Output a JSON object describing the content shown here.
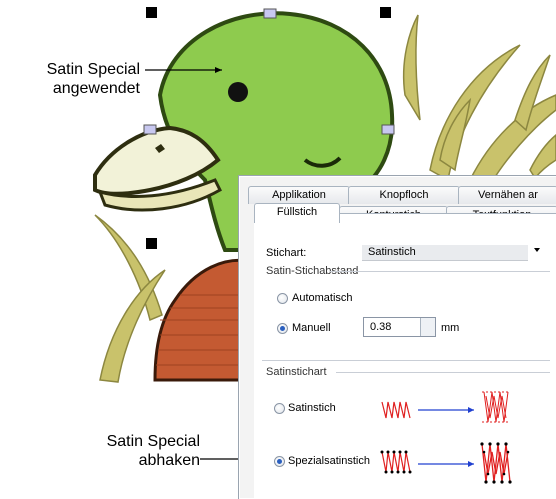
{
  "callouts": {
    "top": [
      "Satin Special",
      "angewendet"
    ],
    "bottom": [
      "Satin Special",
      "abhaken"
    ]
  },
  "dialog": {
    "tabs_back": [
      "Applikation",
      "Knopfloch",
      "Vernähen ar"
    ],
    "tabs_front": [
      "Füllstich",
      "Konturstich",
      "Textfunktion"
    ],
    "active_tab": "Füllstich",
    "stitch_type_label": "Stichart:",
    "stitch_type_value": "Satinstich",
    "spacing_group": "Satin-Stichabstand",
    "auto_label": "Automatisch",
    "manual_label": "Manuell",
    "manual_value": "0.38",
    "unit": "mm",
    "satin_group": "Satinstichart",
    "satin_label": "Satinstich",
    "special_label": "Spezialsatinstich",
    "selected_spacing": "Manuell",
    "selected_satin": "Spezialsatinstich"
  },
  "colors": {
    "head_green": "#8ecb4e",
    "beak": "#f2f2d6",
    "breast": "#c45a32",
    "grass": "#c8c06a",
    "stitch_red": "#e02020",
    "arrow_blue": "#2040d0"
  }
}
